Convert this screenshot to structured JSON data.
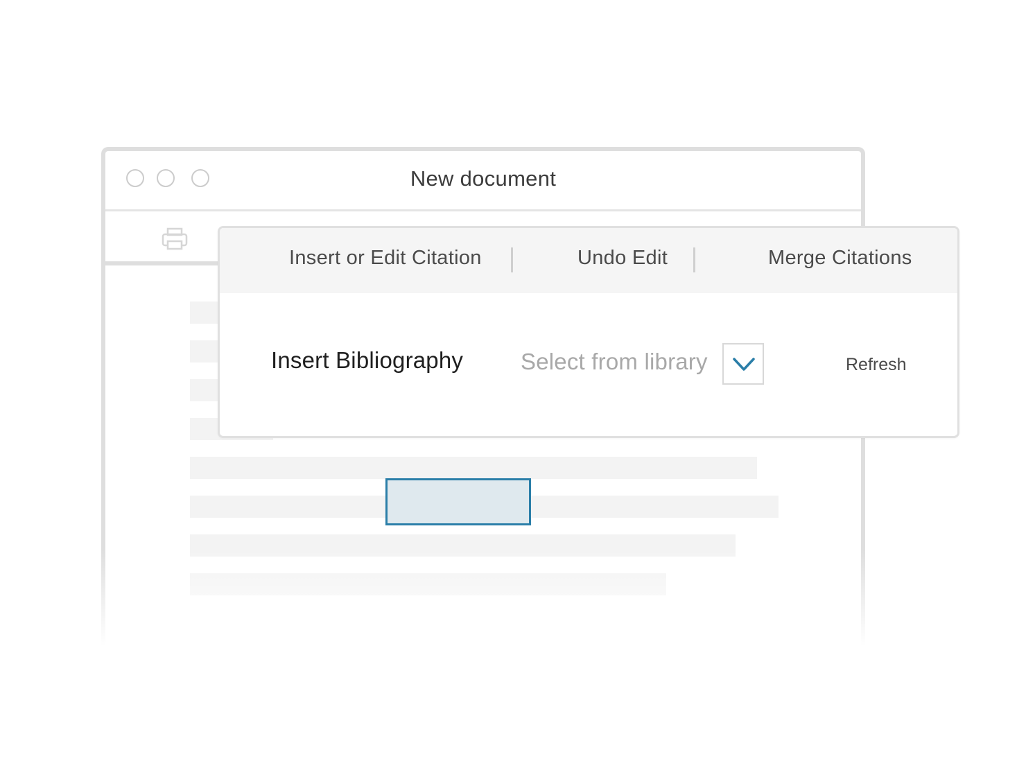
{
  "window": {
    "title": "New document"
  },
  "toolbar": {
    "print_icon": "print-icon"
  },
  "panel": {
    "menu": [
      {
        "label": "Insert or Edit Citation"
      },
      {
        "label": "Undo Edit"
      },
      {
        "label": "Merge Citations"
      }
    ],
    "bibliography": {
      "label": "Insert Bibliography",
      "select_placeholder": "Select from library",
      "dropdown_icon": "chevron-down-icon",
      "refresh_label": "Refresh"
    }
  },
  "colors": {
    "accent": "#2a7ea8",
    "selection_fill": "#dfe9ee",
    "panel_header": "#f5f5f5",
    "window_border": "#dedede"
  }
}
